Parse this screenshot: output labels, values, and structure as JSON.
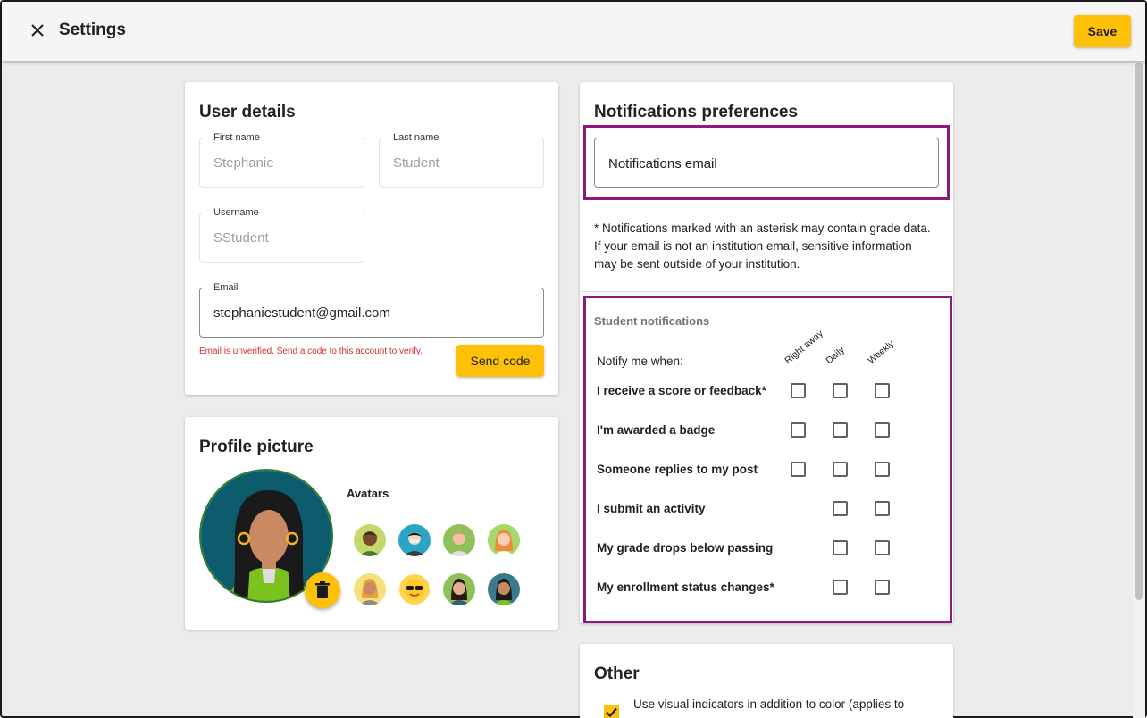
{
  "header": {
    "title": "Settings",
    "save_label": "Save"
  },
  "user_details": {
    "title": "User details",
    "first_name": {
      "label": "First name",
      "value": "Stephanie"
    },
    "last_name": {
      "label": "Last name",
      "value": "Student"
    },
    "username": {
      "label": "Username",
      "value": "SStudent"
    },
    "email": {
      "label": "Email",
      "value": "stephaniestudent@gmail.com"
    },
    "error": "Email is unverified. Send a code to this account to verify.",
    "send_code_label": "Send code"
  },
  "profile_picture": {
    "title": "Profile picture",
    "avatars_label": "Avatars"
  },
  "notifications": {
    "title": "Notifications preferences",
    "email_placeholder": "Notifications email",
    "disclaimer": "* Notifications marked with an asterisk may contain grade data. If your email is not an institution email, sensitive information may be sent outside of your institution.",
    "section_label": "Student notifications",
    "notify_when": "Notify me when:",
    "columns": [
      "Right away",
      "Daily",
      "Weekly"
    ],
    "rows": [
      {
        "label": "I receive a score or feedback*"
      },
      {
        "label": "I'm awarded a badge"
      },
      {
        "label": "Someone replies to my post"
      },
      {
        "label": "I submit an activity"
      },
      {
        "label": "My grade drops below passing"
      },
      {
        "label": "My enrollment status changes*"
      }
    ]
  },
  "other": {
    "title": "Other",
    "visual_indicators": "Use visual indicators in addition to color (applies to",
    "visual_indicators_checked": true
  },
  "colors": {
    "accent": "#ffc107",
    "highlight": "#8b1a7e",
    "error": "#d32f2f"
  }
}
